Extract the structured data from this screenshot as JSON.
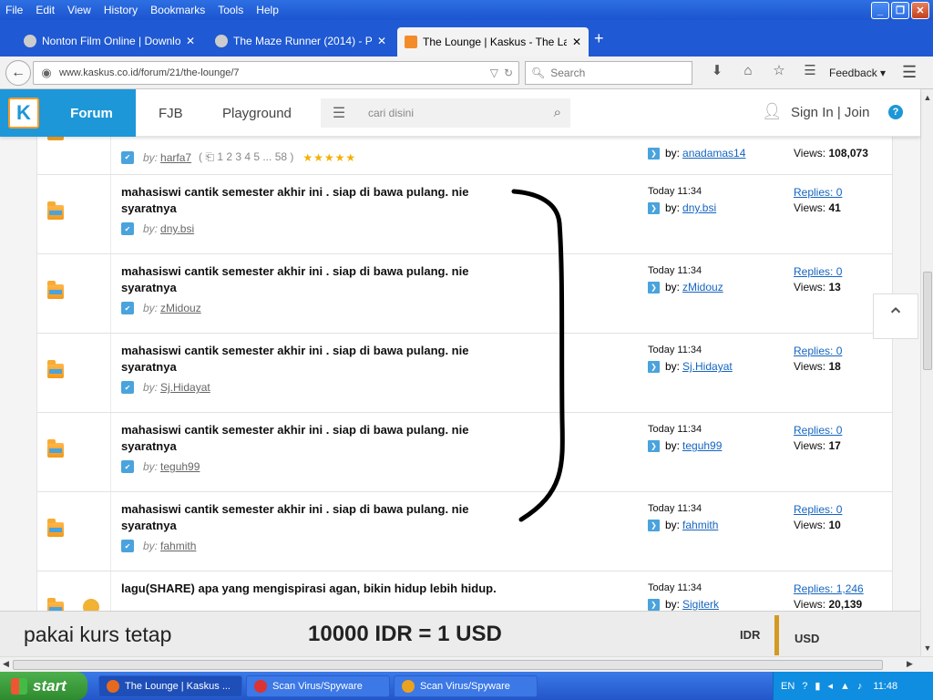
{
  "menu": [
    "File",
    "Edit",
    "View",
    "History",
    "Bookmarks",
    "Tools",
    "Help"
  ],
  "tabs": [
    {
      "label": "Nonton Film Online | Downloa..."
    },
    {
      "label": "The Maze Runner (2014) - Pa..."
    },
    {
      "label": "The Lounge | Kaskus - The La..."
    }
  ],
  "url": "www.kaskus.co.id/forum/21/the-lounge/7",
  "browser_search_placeholder": "Search",
  "feedback_label": "Feedback",
  "site": {
    "logo": "K",
    "nav": [
      "Forum",
      "FJB",
      "Playground"
    ],
    "search_placeholder": "cari disini",
    "signin": "Sign In | Join",
    "help": "?"
  },
  "threads": [
    {
      "title": "",
      "author": "harfa7",
      "pages": "1  2  3  4  5 ... 58 )",
      "stars": "★★★★★",
      "date": "",
      "last_by": "anadamas14",
      "replies": "",
      "views": "108,073"
    },
    {
      "title": "mahasiswi cantik semester akhir ini . siap di bawa pulang. nie syaratnya",
      "author": "dny.bsi",
      "date": "Today 11:34",
      "last_by": "dny.bsi",
      "replies": "Replies: 0",
      "views": "41"
    },
    {
      "title": "mahasiswi cantik semester akhir ini . siap di bawa pulang. nie syaratnya",
      "author": "zMidouz",
      "date": "Today 11:34",
      "last_by": "zMidouz",
      "replies": "Replies: 0",
      "views": "13"
    },
    {
      "title": "mahasiswi cantik semester akhir ini . siap di bawa pulang. nie syaratnya",
      "author": "Sj.Hidayat",
      "date": "Today 11:34",
      "last_by": "Sj.Hidayat",
      "replies": "Replies: 0",
      "views": "18"
    },
    {
      "title": "mahasiswi cantik semester akhir ini . siap di bawa pulang. nie syaratnya",
      "author": "teguh99",
      "date": "Today 11:34",
      "last_by": "teguh99",
      "replies": "Replies: 0",
      "views": "17"
    },
    {
      "title": "mahasiswi cantik semester akhir ini . siap di bawa pulang. nie syaratnya",
      "author": "fahmith",
      "date": "Today 11:34",
      "last_by": "fahmith",
      "replies": "Replies: 0",
      "views": "10"
    },
    {
      "title": "lagu(SHARE) apa yang mengispirasi agan, bikin hidup lebih hidup.",
      "author": "",
      "date": "Today 11:34",
      "last_by": "Sigiterk",
      "replies": "Replies: 1,246",
      "views": "20,139"
    }
  ],
  "labels": {
    "by_italic": "by:",
    "by": "by:",
    "views": "Views:"
  },
  "banner": {
    "text1": "pakai kurs tetap",
    "text2": "10000 IDR = 1 USD",
    "idr": "IDR",
    "usd": "USD"
  },
  "taskbar": {
    "start": "start",
    "tasks": [
      "The Lounge | Kaskus ...",
      "Scan Virus/Spyware",
      "Scan Virus/Spyware"
    ],
    "lang": "EN",
    "clock": "11:48"
  },
  "colors": {
    "accent": "#1d97d7",
    "titlebar": "#1f59d3",
    "link": "#1565c0"
  }
}
